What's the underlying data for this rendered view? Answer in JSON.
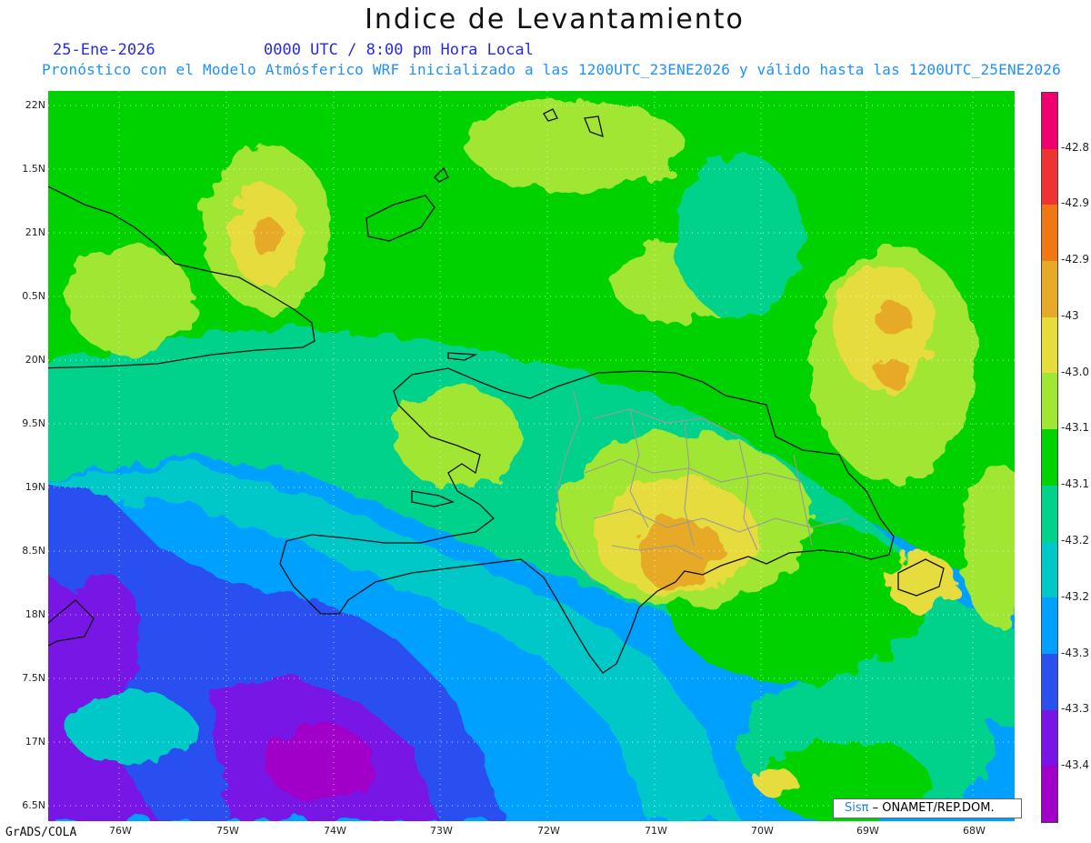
{
  "title": "Indice de Levantamiento",
  "date": "25-Ene-2026",
  "time": "0000 UTC / 8:00 pm Hora Local",
  "forecast": "Pronóstico con el Modelo Atmósferico WRF inicializado a las 1200UTC_23ENE2026 y válido hasta las  1200UTC_25ENE2026",
  "lat_labels": [
    "22N",
    "1.5N",
    "21N",
    "0.5N",
    "20N",
    "9.5N",
    "19N",
    "8.5N",
    "18N",
    "7.5N",
    "17N",
    "6.5N"
  ],
  "lon_labels": [
    "76W",
    "75W",
    "74W",
    "73W",
    "72W",
    "71W",
    "70W",
    "69W",
    "68W"
  ],
  "colorbar": {
    "labels": [
      "-42.8",
      "-42.9",
      "-42.9",
      "-43",
      "-43.0",
      "-43.1",
      "-43.1",
      "-43.2",
      "-43.2",
      "-43.3",
      "-43.3",
      "-43.4"
    ],
    "colors": [
      "#f0006e",
      "#f03232",
      "#f07814",
      "#e6aa28",
      "#e6dc3c",
      "#a0e632",
      "#00d200",
      "#00d28c",
      "#00c8c8",
      "#00a0ff",
      "#2a50f0",
      "#7814e6",
      "#a000c8"
    ]
  },
  "footer": "GrADS/COLA",
  "credit": {
    "logo": "Sisπ",
    "text": "– ONAMET/REP.DOM."
  }
}
